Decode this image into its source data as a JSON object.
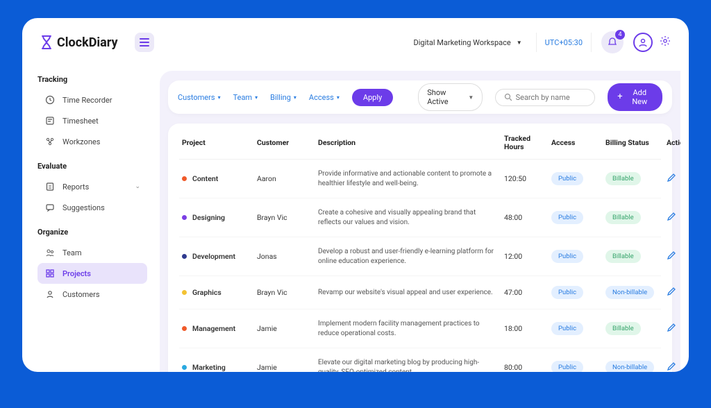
{
  "header": {
    "brand": "ClockDiary",
    "workspace": "Digital Marketing Workspace",
    "timezone": "UTC+05:30",
    "notif_count": "4"
  },
  "sidebar": {
    "groups": [
      {
        "title": "Tracking",
        "items": [
          {
            "label": "Time Recorder",
            "icon": "clock-icon"
          },
          {
            "label": "Timesheet",
            "icon": "timesheet-icon"
          },
          {
            "label": "Workzones",
            "icon": "workzones-icon"
          }
        ]
      },
      {
        "title": "Evaluate",
        "items": [
          {
            "label": "Reports",
            "icon": "reports-icon",
            "expandable": true
          },
          {
            "label": "Suggestions",
            "icon": "suggestions-icon"
          }
        ]
      },
      {
        "title": "Organize",
        "items": [
          {
            "label": "Team",
            "icon": "team-icon"
          },
          {
            "label": "Projects",
            "icon": "projects-icon",
            "active": true
          },
          {
            "label": "Customers",
            "icon": "customers-icon"
          }
        ]
      }
    ]
  },
  "toolbar": {
    "filters": [
      {
        "label": "Customers"
      },
      {
        "label": "Team"
      },
      {
        "label": "Billing"
      },
      {
        "label": "Access"
      }
    ],
    "apply_label": "Apply",
    "show_active_label": "Show Active",
    "search_placeholder": "Search by name",
    "add_new_label": "Add New"
  },
  "table": {
    "headers": {
      "project": "Project",
      "customer": "Customer",
      "description": "Description",
      "tracked": "Tracked Hours",
      "access": "Access",
      "billing": "Billing Status",
      "actions": "Actions"
    },
    "rows": [
      {
        "project": "Content",
        "color": "#f05a2a",
        "customer": "Aaron",
        "description": "Provide informative and actionable content to promote a healthier lifestyle and well-being.",
        "tracked": "120:50",
        "access": "Public",
        "billing": "Billable"
      },
      {
        "project": "Designing",
        "color": "#7b3fe4",
        "customer": "Brayn Vic",
        "description": "Create a cohesive and visually appealing brand that reflects our values and vision.",
        "tracked": "48:00",
        "access": "Public",
        "billing": "Billable"
      },
      {
        "project": "Development",
        "color": "#2f3a8f",
        "customer": "Jonas",
        "description": "Develop a robust and user-friendly e-learning platform for online education experience.",
        "tracked": "12:00",
        "access": "Public",
        "billing": "Billable"
      },
      {
        "project": "Graphics",
        "color": "#f3c233",
        "customer": "Brayn Vic",
        "description": "Revamp our website's visual appeal and user experience.",
        "tracked": "47:00",
        "access": "Public",
        "billing": "Non-billable"
      },
      {
        "project": "Management",
        "color": "#f05a2a",
        "customer": "Jamie",
        "description": "Implement modern facility management practices to reduce operational costs.",
        "tracked": "18:00",
        "access": "Public",
        "billing": "Billable"
      },
      {
        "project": "Marketing",
        "color": "#2aa9e0",
        "customer": "Jamie",
        "description": "Elevate our digital marketing blog by producing high-quality, SEO-optimized content.",
        "tracked": "80:00",
        "access": "Public",
        "billing": "Non-billable"
      }
    ]
  }
}
